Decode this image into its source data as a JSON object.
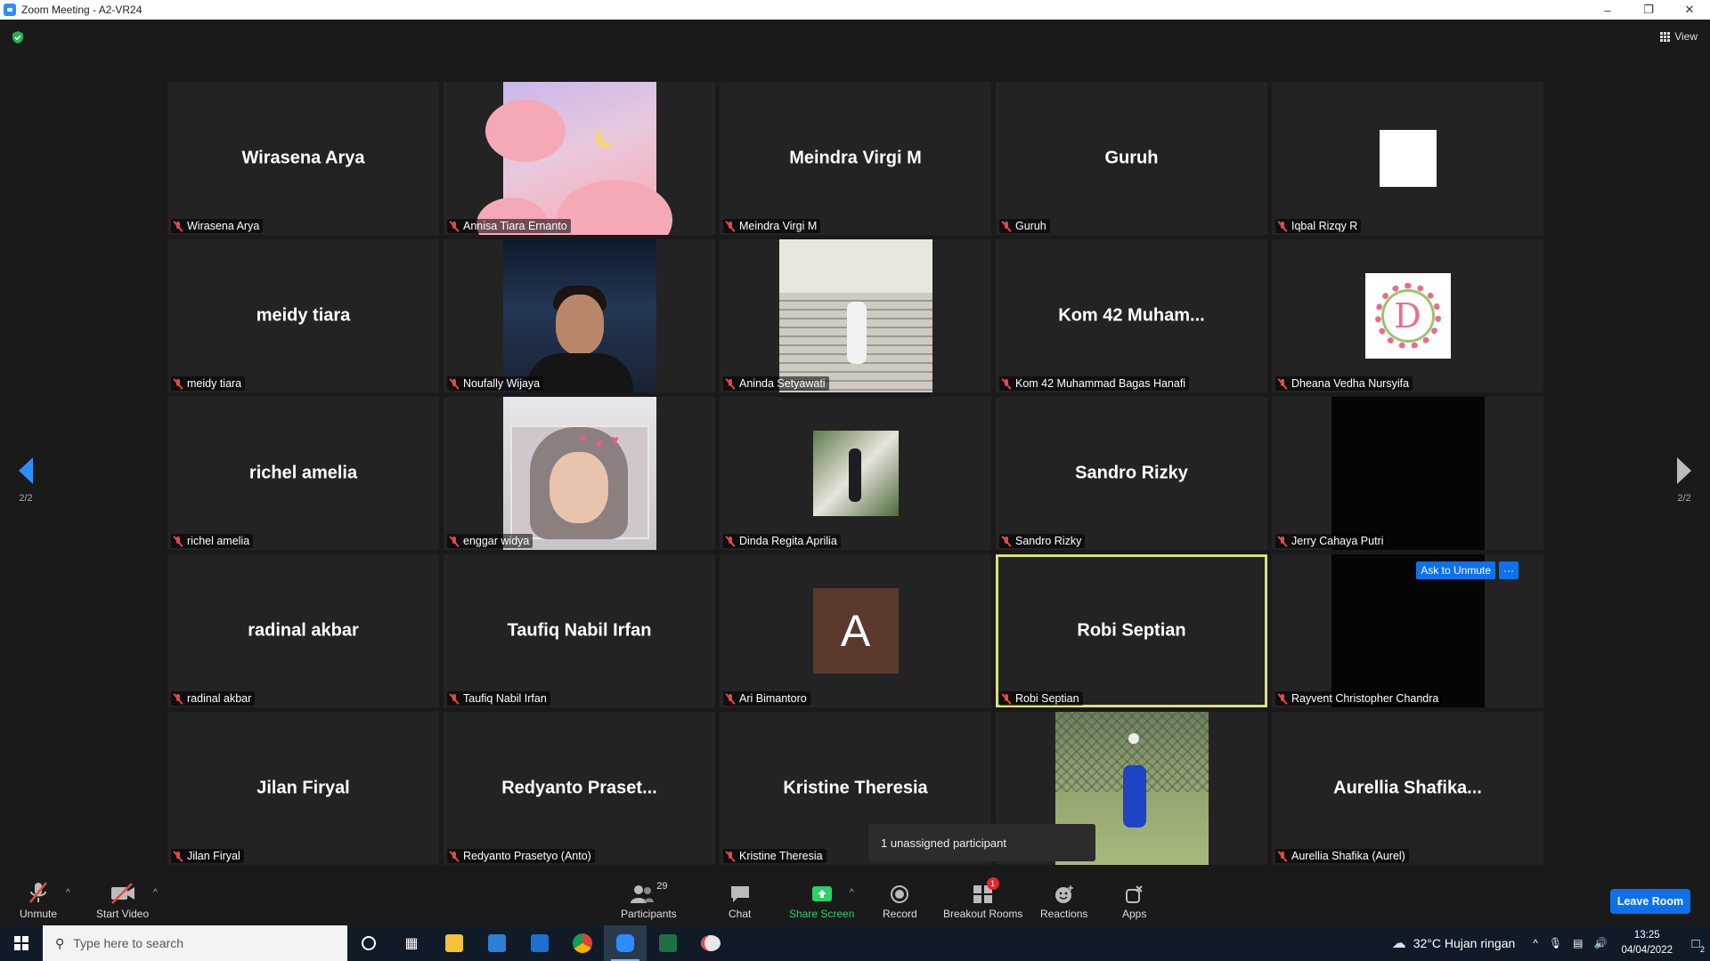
{
  "window": {
    "title": "Zoom Meeting - A2-VR24",
    "minimize": "–",
    "restore": "❐",
    "close": "✕"
  },
  "meeting": {
    "view_label": "View",
    "page_indicator_left": "2/2",
    "page_indicator_right": "2/2",
    "unassigned_banner": "1 unassigned participant",
    "ask_to_unmute": "Ask to Unmute",
    "more_label": "···"
  },
  "tiles": [
    {
      "big": "Wirasena Arya",
      "name": "Wirasena Arya"
    },
    {
      "big": "",
      "name": "Annisa Tiara Ernanto"
    },
    {
      "big": "Meindra Virgi M",
      "name": "Meindra Virgi M"
    },
    {
      "big": "Guruh",
      "name": "Guruh"
    },
    {
      "big": "",
      "name": "Iqbal Rizqy R"
    },
    {
      "big": "meidy tiara",
      "name": "meidy tiara"
    },
    {
      "big": "",
      "name": "Noufally Wijaya"
    },
    {
      "big": "",
      "name": "Aninda Setyawati"
    },
    {
      "big": "Kom 42 Muham...",
      "name": "Kom 42 Muhammad Bagas Hanafi"
    },
    {
      "big": "",
      "name": "Dheana Vedha Nursyifa"
    },
    {
      "big": "richel amelia",
      "name": "richel amelia"
    },
    {
      "big": "",
      "name": "enggar widya"
    },
    {
      "big": "",
      "name": "Dinda Regita Aprilia"
    },
    {
      "big": "Sandro Rizky",
      "name": "Sandro Rizky"
    },
    {
      "big": "",
      "name": "Jerry Cahaya Putri"
    },
    {
      "big": "radinal akbar",
      "name": "radinal akbar"
    },
    {
      "big": "Taufiq Nabil Irfan",
      "name": "Taufiq Nabil Irfan"
    },
    {
      "big": "",
      "name": "Ari Bimantoro",
      "avatar_letter": "A"
    },
    {
      "big": "Robi Septian",
      "name": "Robi Septian"
    },
    {
      "big": "",
      "name": "Rayvent Christopher Chandra"
    },
    {
      "big": "Jilan Firyal",
      "name": "Jilan Firyal"
    },
    {
      "big": "Redyanto  Praset...",
      "name": "Redyanto Prasetyo (Anto)"
    },
    {
      "big": "Kristine Theresia",
      "name": "Kristine Theresia"
    },
    {
      "big": "",
      "name": ""
    },
    {
      "big": "Aurellia  Shafika...",
      "name": "Aurellia Shafika (Aurel)"
    }
  ],
  "toolbar": {
    "unmute": "Unmute",
    "start_video": "Start Video",
    "participants": "Participants",
    "participants_count": "29",
    "chat": "Chat",
    "share_screen": "Share Screen",
    "record": "Record",
    "breakout_rooms": "Breakout Rooms",
    "breakout_badge": "1",
    "reactions": "Reactions",
    "apps": "Apps",
    "leave_room": "Leave Room"
  },
  "taskbar": {
    "search_placeholder": "Type here to search",
    "weather": "32°C  Hujan ringan",
    "time": "13:25",
    "date": "04/04/2022",
    "notif_count": "2"
  },
  "colors": {
    "accent_blue": "#0e71eb",
    "active_speaker": "#d7e27a",
    "muted_red": "#e5483f",
    "share_green": "#2ad164"
  }
}
